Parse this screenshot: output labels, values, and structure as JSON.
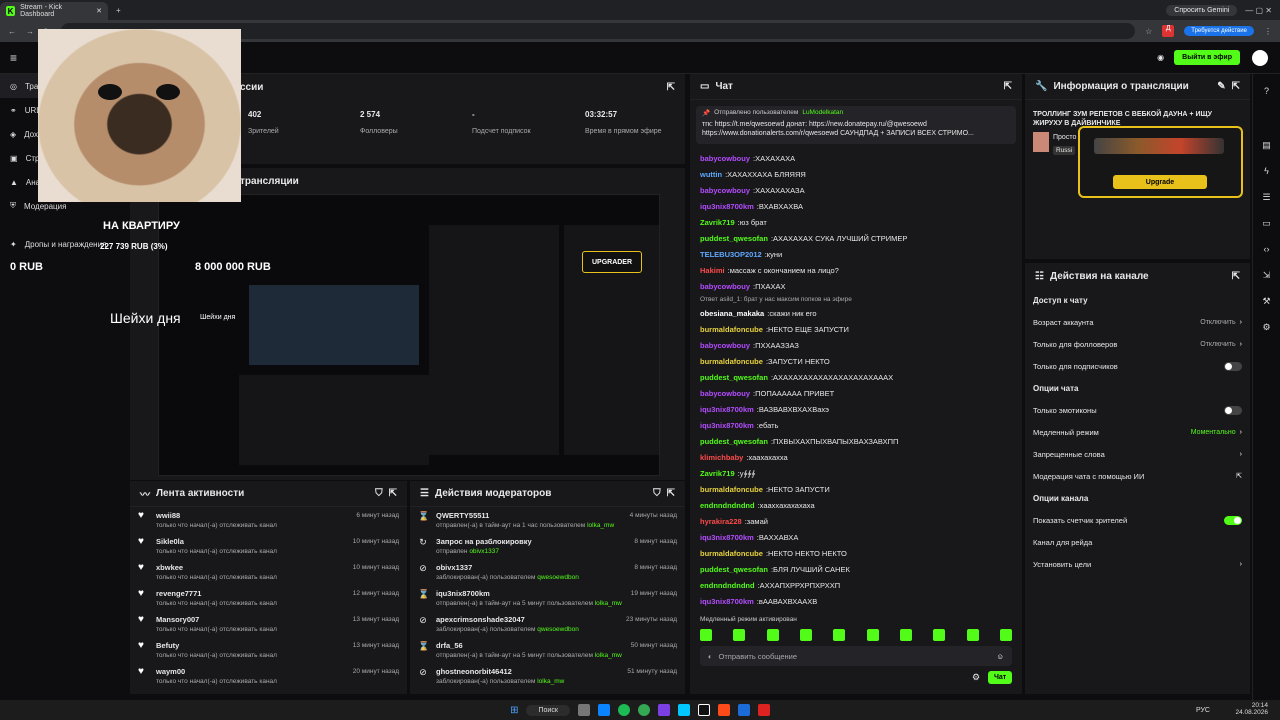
{
  "browser": {
    "tab_title": "Stream - Kick Dashboard",
    "gemini": "Спросить Gemini",
    "update": "Требуется действие",
    "user_initial": "Д"
  },
  "kick": {
    "go_live": "Выйти в эфир"
  },
  "sidebar": {
    "items": [
      {
        "label": "Трансляция"
      },
      {
        "label": "URL и ключ"
      },
      {
        "label": "Доходы"
      },
      {
        "label": "Стрим"
      },
      {
        "label": "Аналитика"
      },
      {
        "label": "Модерация"
      },
      {
        "label": "Дропы и награждения"
      }
    ]
  },
  "overlay": {
    "goal_title": "НА КВАРТИРУ",
    "goal_amount": "227 739 RUB (3%)",
    "goal_min": "0 RUB",
    "goal_max": "8 000 000 RUB",
    "sheikh": "Шейхи дня",
    "sheikh_small": "Шейхи дня"
  },
  "session": {
    "title": "ссии",
    "stats": [
      {
        "value": "402",
        "label": "Зрителей"
      },
      {
        "value": "2 574",
        "label": "Фолловеры"
      },
      {
        "value": "-",
        "label": "Подсчет подписок"
      },
      {
        "value": "03:32:57",
        "label": "Время в прямом эфире"
      }
    ]
  },
  "preview": {
    "title": "трансляции",
    "upgrader": "UPGRADER"
  },
  "activity": {
    "title": "Лента активности",
    "rows": [
      {
        "name": "wwii88",
        "sub": "только что начал(-а) отслеживать канал",
        "time": "6 минут назад"
      },
      {
        "name": "Sikle0la",
        "sub": "только что начал(-а) отслеживать канал",
        "time": "10 минут назад"
      },
      {
        "name": "xbwkee",
        "sub": "только что начал(-а) отслеживать канал",
        "time": "10 минут назад"
      },
      {
        "name": "revenge7771",
        "sub": "только что начал(-а) отслеживать канал",
        "time": "12 минут назад"
      },
      {
        "name": "Mansory007",
        "sub": "только что начал(-а) отслеживать канал",
        "time": "13 минут назад"
      },
      {
        "name": "Befuty",
        "sub": "только что начал(-а) отслеживать канал",
        "time": "13 минут назад"
      },
      {
        "name": "waym00",
        "sub": "только что начал(-а) отслеживать канал",
        "time": "20 минут назад"
      }
    ]
  },
  "mods": {
    "title": "Действия модераторов",
    "rows": [
      {
        "icon": "⌛",
        "name": "QWERTY55511",
        "pre": "отправлен(-а) в тайм-аут на 1 час пользователем ",
        "by": "lolka_mw",
        "time": "4 минуты назад"
      },
      {
        "icon": "↻",
        "name": "Запрос на разблокировку",
        "pre": "отправлен ",
        "by": "obivx1337",
        "time": "8 минут назад"
      },
      {
        "icon": "⊘",
        "name": "obivx1337",
        "pre": "заблокирован(-а) пользователем ",
        "by": "qwesoewdbon",
        "time": "8 минут назад"
      },
      {
        "icon": "⌛",
        "name": "iqu3nix8700km",
        "pre": "отправлен(-а) в тайм-аут на 5 минут пользователем ",
        "by": "lolka_mw",
        "time": "19 минут назад"
      },
      {
        "icon": "⊘",
        "name": "apexcrimsonshade32047",
        "pre": "заблокирован(-а) пользователем ",
        "by": "qwesoewdbon",
        "time": "23 минуты назад"
      },
      {
        "icon": "⌛",
        "name": "drfa_56",
        "pre": "отправлен(-а) в тайм-аут на 5 минут пользователем ",
        "by": "lolka_mw",
        "time": "50 минут назад"
      },
      {
        "icon": "⊘",
        "name": "ghostneonorbit46412",
        "pre": "заблокирован(-а) пользователем ",
        "by": "lolka_mw",
        "time": "51 минуту назад"
      }
    ]
  },
  "chat": {
    "title": "Чат",
    "pinned_by": "Отправлено пользователем",
    "pinned_user": "LuModelkatan",
    "pinned_text": "тгк: https://t.me/qwesoewd донат: https://new.donatepay.ru/@qwesoewd https://www.donationalerts.com/r/qwesoewd САУНДПАД + ЗАПИСИ ВСЕХ СТРИМО...",
    "reply_note": "Ответ asild_1: брат у нас максим попков на эфире",
    "slow_mode": "Медленный режим активирован",
    "input_placeholder": "Отправить сообщение",
    "send": "Чат",
    "messages": [
      {
        "user": "babycowbouy",
        "color": "#b44cff",
        "text": "ХАХАХАХА"
      },
      {
        "user": "wuttin",
        "color": "#5fa8ff",
        "text": "ХАХАХХАХА БЛЯЯЯЯ"
      },
      {
        "user": "babycowbouy",
        "color": "#b44cff",
        "text": "ХАХАХАХАЗА"
      },
      {
        "user": "iqu3nix8700km",
        "color": "#b44cff",
        "text": "ВХАВХАХВА"
      },
      {
        "user": "Zavrik719",
        "color": "#53fc18",
        "text": "юз брат"
      },
      {
        "user": "puddest_qwesofan",
        "color": "#53fc18",
        "text": "АХАХАХАХ СУКА ЛУЧШИЙ СТРИМЕР"
      },
      {
        "user": "TELEBU3OP2012",
        "color": "#5fa8ff",
        "text": "куни"
      },
      {
        "user": "Hakimi",
        "color": "#ff4a4a",
        "text": "массаж с окончанием на лицо?"
      },
      {
        "user": "babycowbouy",
        "color": "#b44cff",
        "text": "ПХАХАХ"
      },
      {
        "user": "obesiana_makaka",
        "color": "#ffffff",
        "text": "скажи ник его"
      },
      {
        "user": "burmaldafoncube",
        "color": "#e8d23a",
        "text": "НЕКТО ЕЩЕ ЗАПУСТИ"
      },
      {
        "user": "babycowbouy",
        "color": "#b44cff",
        "text": "ПХХААЗЗАЗ"
      },
      {
        "user": "burmaldafoncube",
        "color": "#e8d23a",
        "text": "ЗАПУСТИ НЕКТО"
      },
      {
        "user": "puddest_qwesofan",
        "color": "#53fc18",
        "text": "АХАХАХАХАХАХАХАХАХАХАААХ"
      },
      {
        "user": "babycowbouy",
        "color": "#b44cff",
        "text": "ПОПАААААА ПРИВЕТ"
      },
      {
        "user": "iqu3nix8700km",
        "color": "#b44cff",
        "text": "ВАЗВАВХВХАХВахэ"
      },
      {
        "user": "iqu3nix8700km",
        "color": "#b44cff",
        "text": "ебать"
      },
      {
        "user": "puddest_qwesofan",
        "color": "#53fc18",
        "text": "ПХВЫХАХПЫХВАПЫХВАХЗАВХПП"
      },
      {
        "user": "klimichbaby",
        "color": "#ff4a4a",
        "text": "хаахахахха"
      },
      {
        "user": "Zavrik719",
        "color": "#53fc18",
        "text": "у∲∲∲"
      },
      {
        "user": "burmaldafoncube",
        "color": "#e8d23a",
        "text": "НЕКТО ЗАПУСТИ"
      },
      {
        "user": "endnndndndnd",
        "color": "#53fc18",
        "text": "хааххахахахаха"
      },
      {
        "user": "hyrakira228",
        "color": "#ff4a4a",
        "text": "замай"
      },
      {
        "user": "iqu3nix8700km",
        "color": "#b44cff",
        "text": "ВАХХАВХА"
      },
      {
        "user": "burmaldafoncube",
        "color": "#e8d23a",
        "text": "НЕКТО НЕКТО НЕКТО"
      },
      {
        "user": "puddest_qwesofan",
        "color": "#53fc18",
        "text": "БЛЯ ЛУЧШИЙ САНЕК"
      },
      {
        "user": "endnndndndnd",
        "color": "#53fc18",
        "text": "АХХАПХРРХРПХРХХП"
      },
      {
        "user": "iqu3nix8700km",
        "color": "#b44cff",
        "text": "вААВАХВХААХВ"
      }
    ]
  },
  "info": {
    "title": "Информация о трансляции",
    "stream_title": "ТРОЛЛИНГ ЗУМ РЕПЕТОВ С ВЕБКОЙ ДАУНА + ИЩУ ЖИРУХУ В ДАЙВИНЧИКЕ",
    "category": "Просто",
    "tag": "Russi",
    "upgrade": "Upgrade"
  },
  "actions": {
    "title": "Действия на канале",
    "sections": [
      {
        "head": "Доступ к чату",
        "rows": [
          {
            "label": "Возраст аккаунта",
            "value": "Отключить",
            "kind": "chevron"
          },
          {
            "label": "Только для фолловеров",
            "value": "Отключить",
            "kind": "chevron"
          },
          {
            "label": "Только для подписчиков",
            "value": "",
            "kind": "toggle-off"
          }
        ]
      },
      {
        "head": "Опции чата",
        "rows": [
          {
            "label": "Только эмотиконы",
            "value": "",
            "kind": "toggle-off"
          },
          {
            "label": "Медленный режим",
            "value": "Моментально",
            "kind": "chevron-green"
          },
          {
            "label": "Запрещенные слова",
            "value": "",
            "kind": "chevron"
          },
          {
            "label": "Модерация чата с помощью ИИ",
            "value": "",
            "kind": "external"
          }
        ]
      },
      {
        "head": "Опции канала",
        "rows": [
          {
            "label": "Показать счетчик зрителей",
            "value": "",
            "kind": "toggle-on"
          },
          {
            "label": "Канал для рейда",
            "value": "",
            "kind": "none"
          },
          {
            "label": "Установить цели",
            "value": "",
            "kind": "chevron"
          }
        ]
      }
    ]
  },
  "taskbar": {
    "search": "Поиск",
    "lang": "РУС",
    "time": "20:14",
    "date": "24.08.2026"
  }
}
